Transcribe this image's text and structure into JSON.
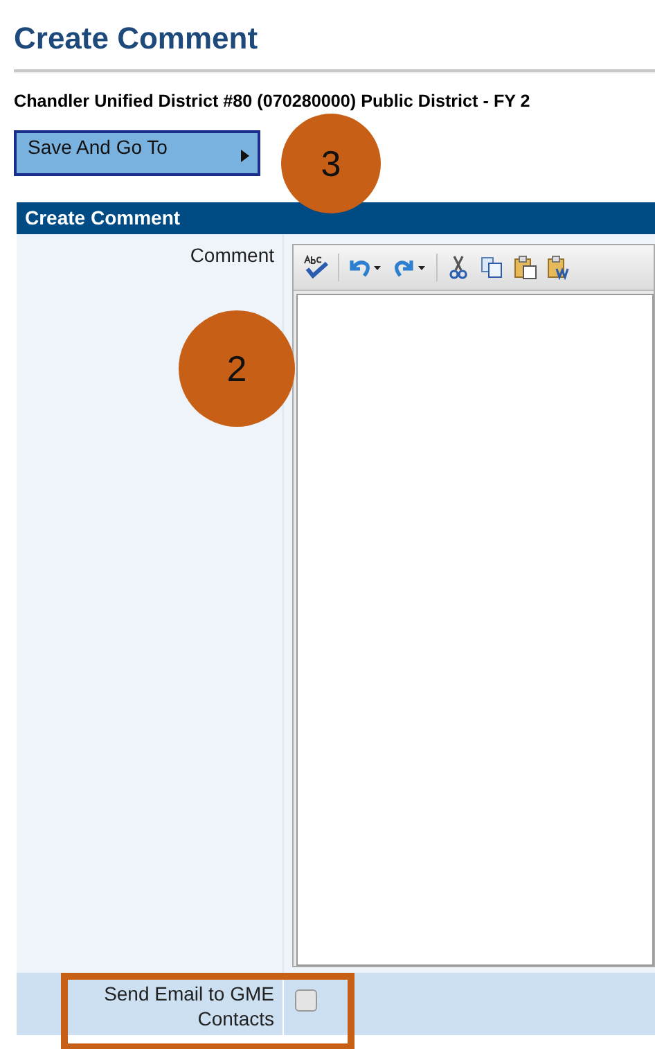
{
  "page": {
    "title": "Create Comment",
    "subtitle": "Chandler Unified District #80 (070280000) Public District - FY 2",
    "save_button": "Save And Go To"
  },
  "panel": {
    "title": "Create Comment",
    "comment_label": "Comment",
    "email": {
      "label": "Send Email to GME Contacts",
      "checked": false
    }
  },
  "callouts": [
    {
      "label": "3"
    },
    {
      "label": "2"
    }
  ]
}
